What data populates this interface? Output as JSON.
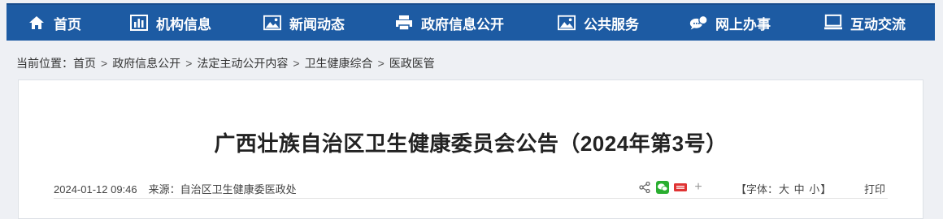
{
  "nav": {
    "items": [
      {
        "label": "首页",
        "icon": "home-icon"
      },
      {
        "label": "机构信息",
        "icon": "bar-chart-icon"
      },
      {
        "label": "新闻动态",
        "icon": "image-icon"
      },
      {
        "label": "政府信息公开",
        "icon": "printer-icon"
      },
      {
        "label": "公共服务",
        "icon": "image-icon"
      },
      {
        "label": "网上办事",
        "icon": "chat-bubbles-icon"
      },
      {
        "label": "互动交流",
        "icon": "monitor-icon"
      }
    ]
  },
  "breadcrumb": {
    "prefix": "当前位置：",
    "items": [
      "首页",
      "政府信息公开",
      "法定主动公开内容",
      "卫生健康综合",
      "医政医管"
    ],
    "separator": ">"
  },
  "article": {
    "title": "广西壮族自治区卫生健康委员会公告（2024年第3号）",
    "date": "2024-01-12 09:46",
    "source_label": "来源：",
    "source": "自治区卫生健康委医政处"
  },
  "toolbar": {
    "font_prefix": "【字体：",
    "font_large": "大",
    "font_medium": "中",
    "font_small": "小",
    "font_suffix": "】",
    "print_label": "打印",
    "share_more": "+"
  }
}
